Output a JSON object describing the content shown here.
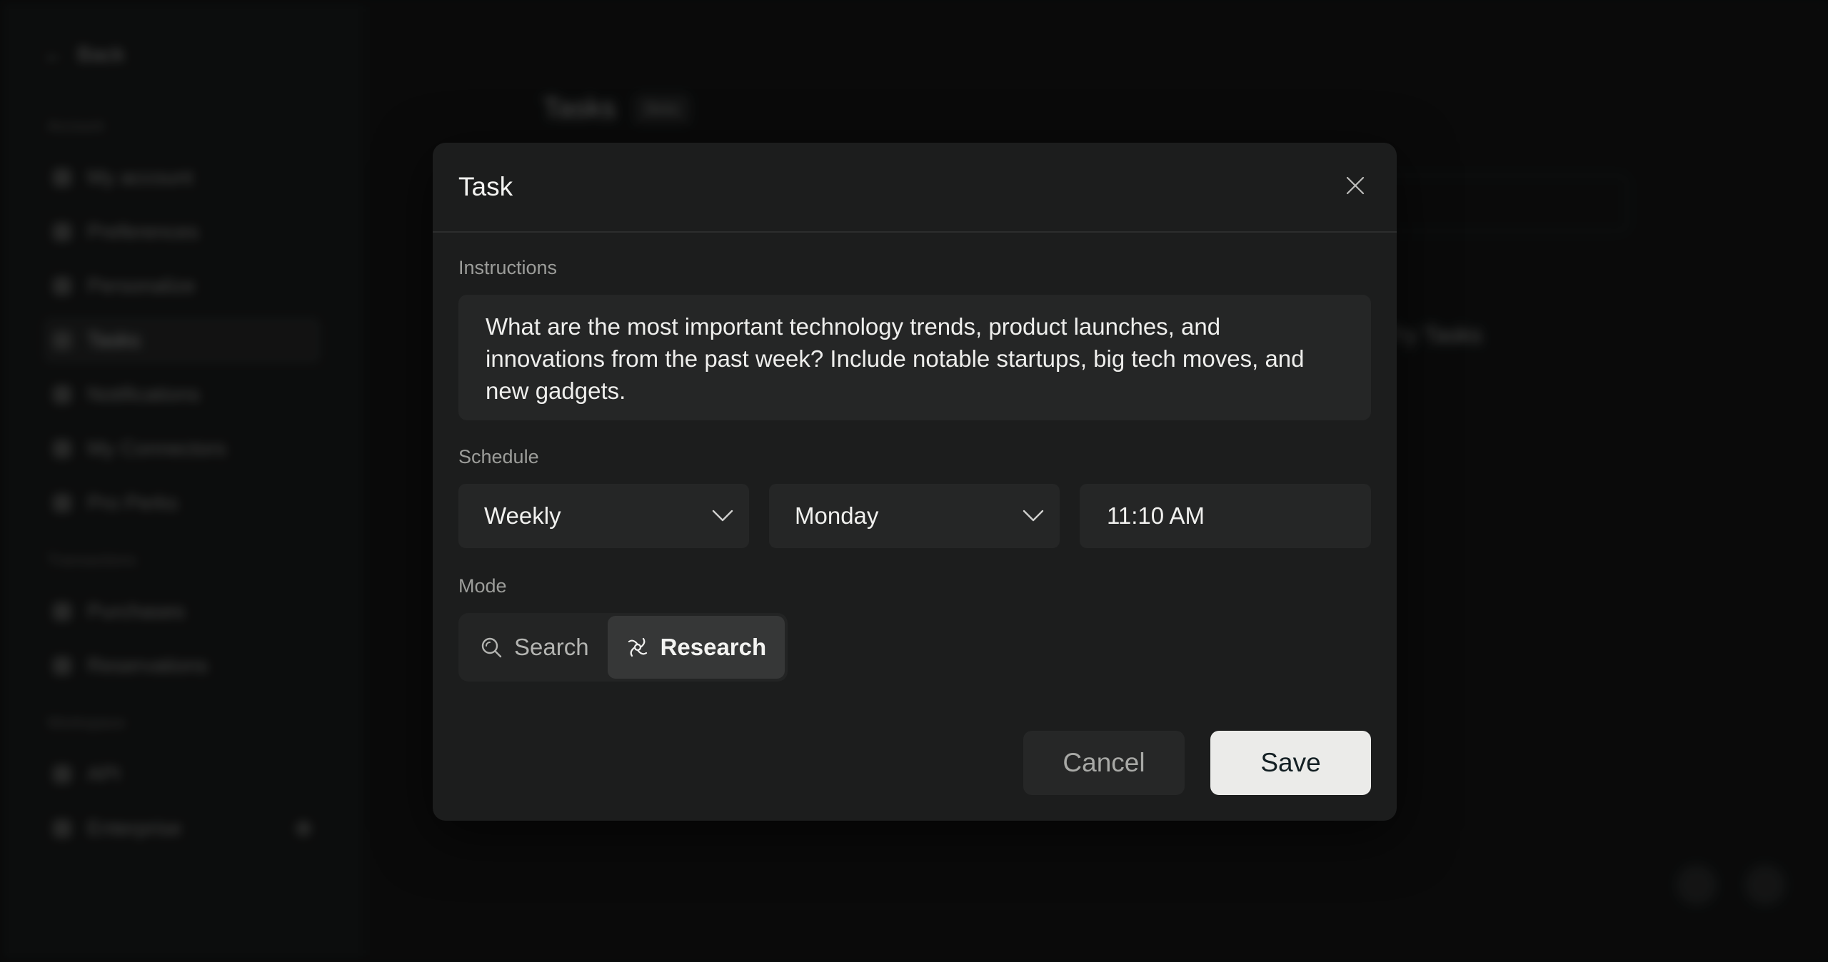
{
  "background": {
    "back_label": "Back",
    "sections": [
      {
        "label": "Account",
        "items": [
          "My account",
          "Preferences",
          "Personalize",
          "Tasks",
          "Notifications",
          "My Connectors",
          "Pro Perks"
        ]
      },
      {
        "label": "Transactions",
        "items": [
          "Purchases",
          "Reservations"
        ]
      },
      {
        "label": "Workspace",
        "items": [
          "API",
          "Enterprise"
        ]
      }
    ],
    "main_title": "Tasks",
    "main_chip": "Beta",
    "right_heading": "Try Tasks"
  },
  "modal": {
    "title": "Task",
    "instructions_label": "Instructions",
    "instructions_text": "What are the most important technology trends, product launches, and innovations from the past week? Include notable startups, big tech moves, and new gadgets.",
    "schedule_label": "Schedule",
    "frequency": "Weekly",
    "day": "Monday",
    "time": "11:10 AM",
    "mode_label": "Mode",
    "modes": [
      {
        "label": "Search",
        "icon": "search-icon",
        "active": false
      },
      {
        "label": "Research",
        "icon": "research-icon",
        "active": true
      }
    ],
    "cancel_label": "Cancel",
    "save_label": "Save"
  },
  "colors": {
    "modal_bg": "#1c1d1d",
    "field_bg": "#252626",
    "save_bg": "#ebebe9",
    "active_mode_bg": "#363737"
  }
}
